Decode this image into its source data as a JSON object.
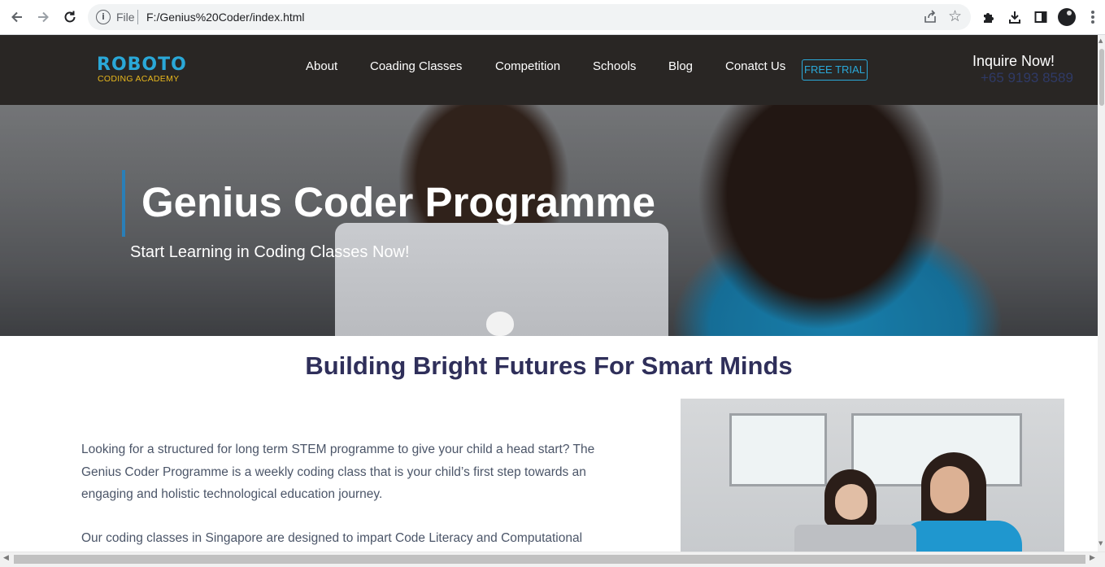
{
  "browser": {
    "back_icon": "arrow-left-icon",
    "forward_icon": "arrow-right-icon",
    "reload_icon": "reload-icon",
    "site_info_icon": "info-icon",
    "scheme_label": "File",
    "url": "F:/Genius%20Coder/index.html",
    "share_icon": "share-icon",
    "bookmark_icon": "star-icon",
    "extensions_icon": "puzzle-icon",
    "downloads_icon": "download-icon",
    "side_panel_icon": "side-panel-icon",
    "profile_icon": "profile-avatar-icon",
    "menu_icon": "kebab-menu-icon"
  },
  "header": {
    "logo_top": "ROBOTO",
    "logo_bottom": "CODING ACADEMY",
    "nav": [
      "About",
      "Coading Classes",
      "Competition",
      "Schools",
      "Blog",
      "Conatct Us"
    ],
    "trial_label": "FREE TRIAL",
    "inquire_label": "Inquire Now!",
    "phone": "+65 9193 8589",
    "colors": {
      "background": "#292624",
      "accent": "#2aa8d8",
      "logo_gold": "#e8b81d",
      "phone": "#2f3a66"
    }
  },
  "hero": {
    "title": "Genius Coder Programme",
    "subtitle": "Start Learning in Coding Classes Now!",
    "bar_color": "#2a7fb8"
  },
  "section": {
    "title": "Building Bright Futures For Smart Minds",
    "paragraph1": "Looking for a structured for long term STEM programme to give your child a head start? The Genius Coder Programme is a weekly coding class that is your child’s first step towards an engaging and holistic technological education journey.",
    "paragraph2": "Our coding classes in Singapore are designed to impart Code Literacy and Computational",
    "title_color": "#2f2f5a",
    "text_color": "#4b5568"
  }
}
